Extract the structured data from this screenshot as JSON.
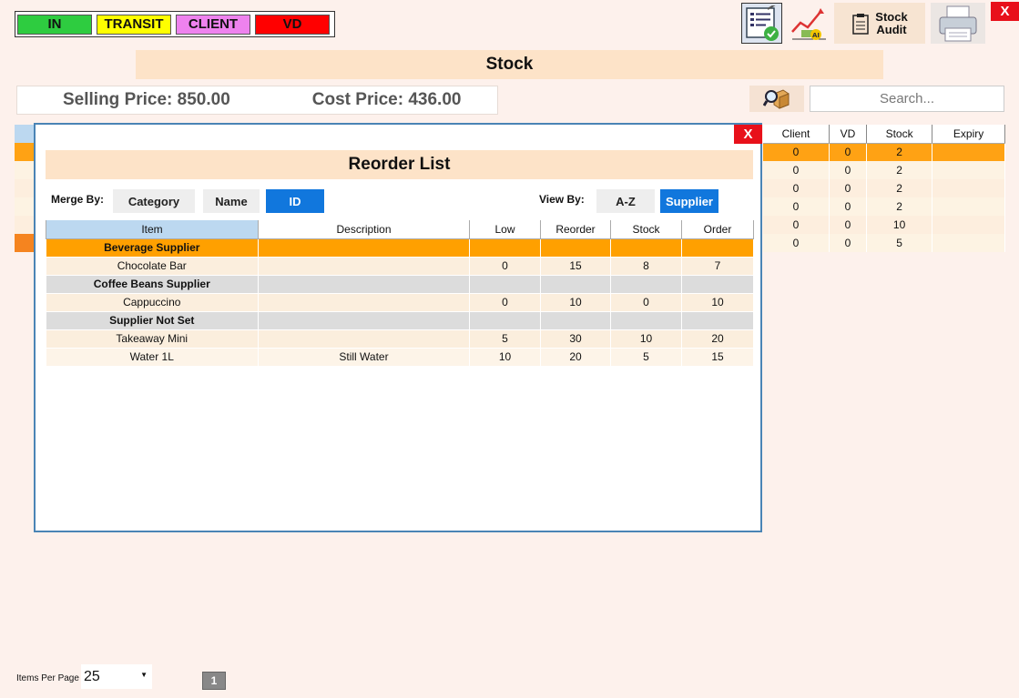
{
  "legend": {
    "in": "IN",
    "transit": "TRANSIT",
    "client": "CLIENT",
    "vd": "VD"
  },
  "toolbar": {
    "audit_label_1": "Stock",
    "audit_label_2": "Audit",
    "ai_badge": "AI"
  },
  "close_label": "X",
  "page_title": "Stock",
  "prices": {
    "selling": "Selling Price: 850.00",
    "cost": "Cost Price: 436.00"
  },
  "search": {
    "placeholder": "Search..."
  },
  "bg_table": {
    "headers": [
      "Client",
      "VD",
      "Stock",
      "Expiry"
    ],
    "rows": [
      [
        "0",
        "0",
        "2",
        ""
      ],
      [
        "0",
        "0",
        "2",
        ""
      ],
      [
        "0",
        "0",
        "2",
        ""
      ],
      [
        "0",
        "0",
        "2",
        ""
      ],
      [
        "0",
        "0",
        "10",
        ""
      ],
      [
        "0",
        "0",
        "5",
        ""
      ]
    ]
  },
  "modal": {
    "title": "Reorder List",
    "close": "X",
    "merge_by": {
      "label": "Merge By:",
      "options": [
        "Category",
        "Name",
        "ID"
      ],
      "selected": "ID"
    },
    "view_by": {
      "label": "View By:",
      "options": [
        "A-Z",
        "Supplier"
      ],
      "selected": "Supplier"
    },
    "table": {
      "headers": [
        "Item",
        "Description",
        "Low",
        "Reorder",
        "Stock",
        "Order"
      ],
      "rows": [
        {
          "group": "Beverage Supplier"
        },
        {
          "item": "Chocolate Bar",
          "description": "",
          "low": "0",
          "reorder": "15",
          "stock": "8",
          "order": "7"
        },
        {
          "group": "Coffee Beans Supplier"
        },
        {
          "item": "Cappuccino",
          "description": "",
          "low": "0",
          "reorder": "10",
          "stock": "0",
          "order": "10"
        },
        {
          "group": "Supplier Not Set"
        },
        {
          "item": "Takeaway Mini",
          "description": "",
          "low": "5",
          "reorder": "30",
          "stock": "10",
          "order": "20"
        },
        {
          "item": "Water 1L",
          "description": "Still Water",
          "low": "10",
          "reorder": "20",
          "stock": "5",
          "order": "15"
        }
      ]
    }
  },
  "footer": {
    "items_per_page_label": "Items Per Page",
    "items_per_page_value": "25",
    "page": "1"
  },
  "colors": {
    "in": "#2ecc40",
    "transit": "#ffff00",
    "client": "#ee82ee",
    "vd": "#ff0000",
    "accent": "#1177dd",
    "group_orange": "#ffa000",
    "close_red": "#e8101a"
  }
}
